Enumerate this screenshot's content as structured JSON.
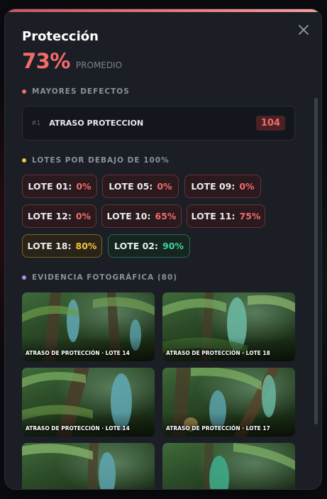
{
  "modal": {
    "title": "Protección",
    "percent": "73%",
    "percent_label": "PROMEDIO"
  },
  "sections": {
    "defects": "MAYORES DEFECTOS",
    "lots": "LOTES POR DEBAJO DE 100%",
    "photos": "EVIDENCIA FOTOGRÁFICA (80)"
  },
  "defects": [
    {
      "rank": "#1",
      "name": "ATRASO PROTECCION",
      "count": "104"
    }
  ],
  "lots": [
    {
      "label": "LOTE 01:",
      "value": "0%",
      "status": "red"
    },
    {
      "label": "LOTE 05:",
      "value": "0%",
      "status": "red"
    },
    {
      "label": "LOTE 09:",
      "value": "0%",
      "status": "red"
    },
    {
      "label": "LOTE 12:",
      "value": "0%",
      "status": "red"
    },
    {
      "label": "LOTE 10:",
      "value": "65%",
      "status": "red"
    },
    {
      "label": "LOTE 11:",
      "value": "75%",
      "status": "red"
    },
    {
      "label": "LOTE 18:",
      "value": "80%",
      "status": "yellow"
    },
    {
      "label": "LOTE 02:",
      "value": "90%",
      "status": "green"
    }
  ],
  "photos": [
    {
      "caption": "ATRASO DE PROTECCIÓN · LOTE 14"
    },
    {
      "caption": "ATRASO DE PROTECCIÓN · LOTE 18"
    },
    {
      "caption": "ATRASO DE PROTECCIÓN · LOTE 14"
    },
    {
      "caption": "ATRASO DE PROTECCIÓN · LOTE 17"
    },
    {
      "caption": ""
    },
    {
      "caption": ""
    }
  ],
  "colors": {
    "accent_red": "#f26b6b",
    "accent_yellow": "#f1c43b",
    "accent_green": "#3ed39b",
    "accent_purple": "#b08cf0"
  },
  "icons": {
    "close": "close-icon",
    "section_dot": "dot-icon"
  }
}
